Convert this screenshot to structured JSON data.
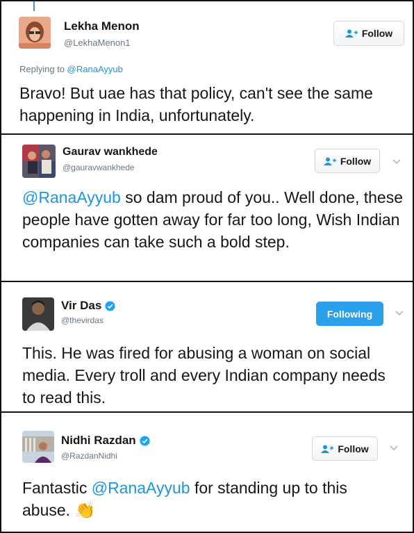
{
  "tweets": [
    {
      "name": "Lekha Menon",
      "handle": "@LekhaMenon1",
      "verified": false,
      "follow_label": "Follow",
      "following": false,
      "reply_prefix": "Replying to",
      "reply_mention": "@RanaAyyub",
      "text_mention": "",
      "text_before": "",
      "text": "Bravo! But uae has that policy, can't see the same happening in India, unfortunately."
    },
    {
      "name": "Gaurav wankhede",
      "handle": "@gauravwankhede",
      "verified": false,
      "follow_label": "Follow",
      "following": false,
      "text_mention": "@RanaAyyub",
      "text": " so dam proud of you.. Well done, these people have gotten away for far too long, Wish Indian companies can take such a bold step."
    },
    {
      "name": "Vir Das",
      "handle": "@thevirdas",
      "verified": true,
      "follow_label": "Following",
      "following": true,
      "text_mention": "",
      "text": "This. He was fired for abusing a woman on social media. Every troll and every Indian company needs to read this."
    },
    {
      "name": "Nidhi Razdan",
      "handle": "@RazdanNidhi",
      "verified": true,
      "follow_label": "Follow",
      "following": false,
      "text_before": "Fantastic ",
      "text_mention": "@RanaAyyub",
      "text": " for standing up to this abuse. ",
      "emoji": "👏"
    }
  ],
  "colors": {
    "link": "#1b95e0",
    "following_bg": "#2aa0ea",
    "verified": "#1da1f2"
  }
}
